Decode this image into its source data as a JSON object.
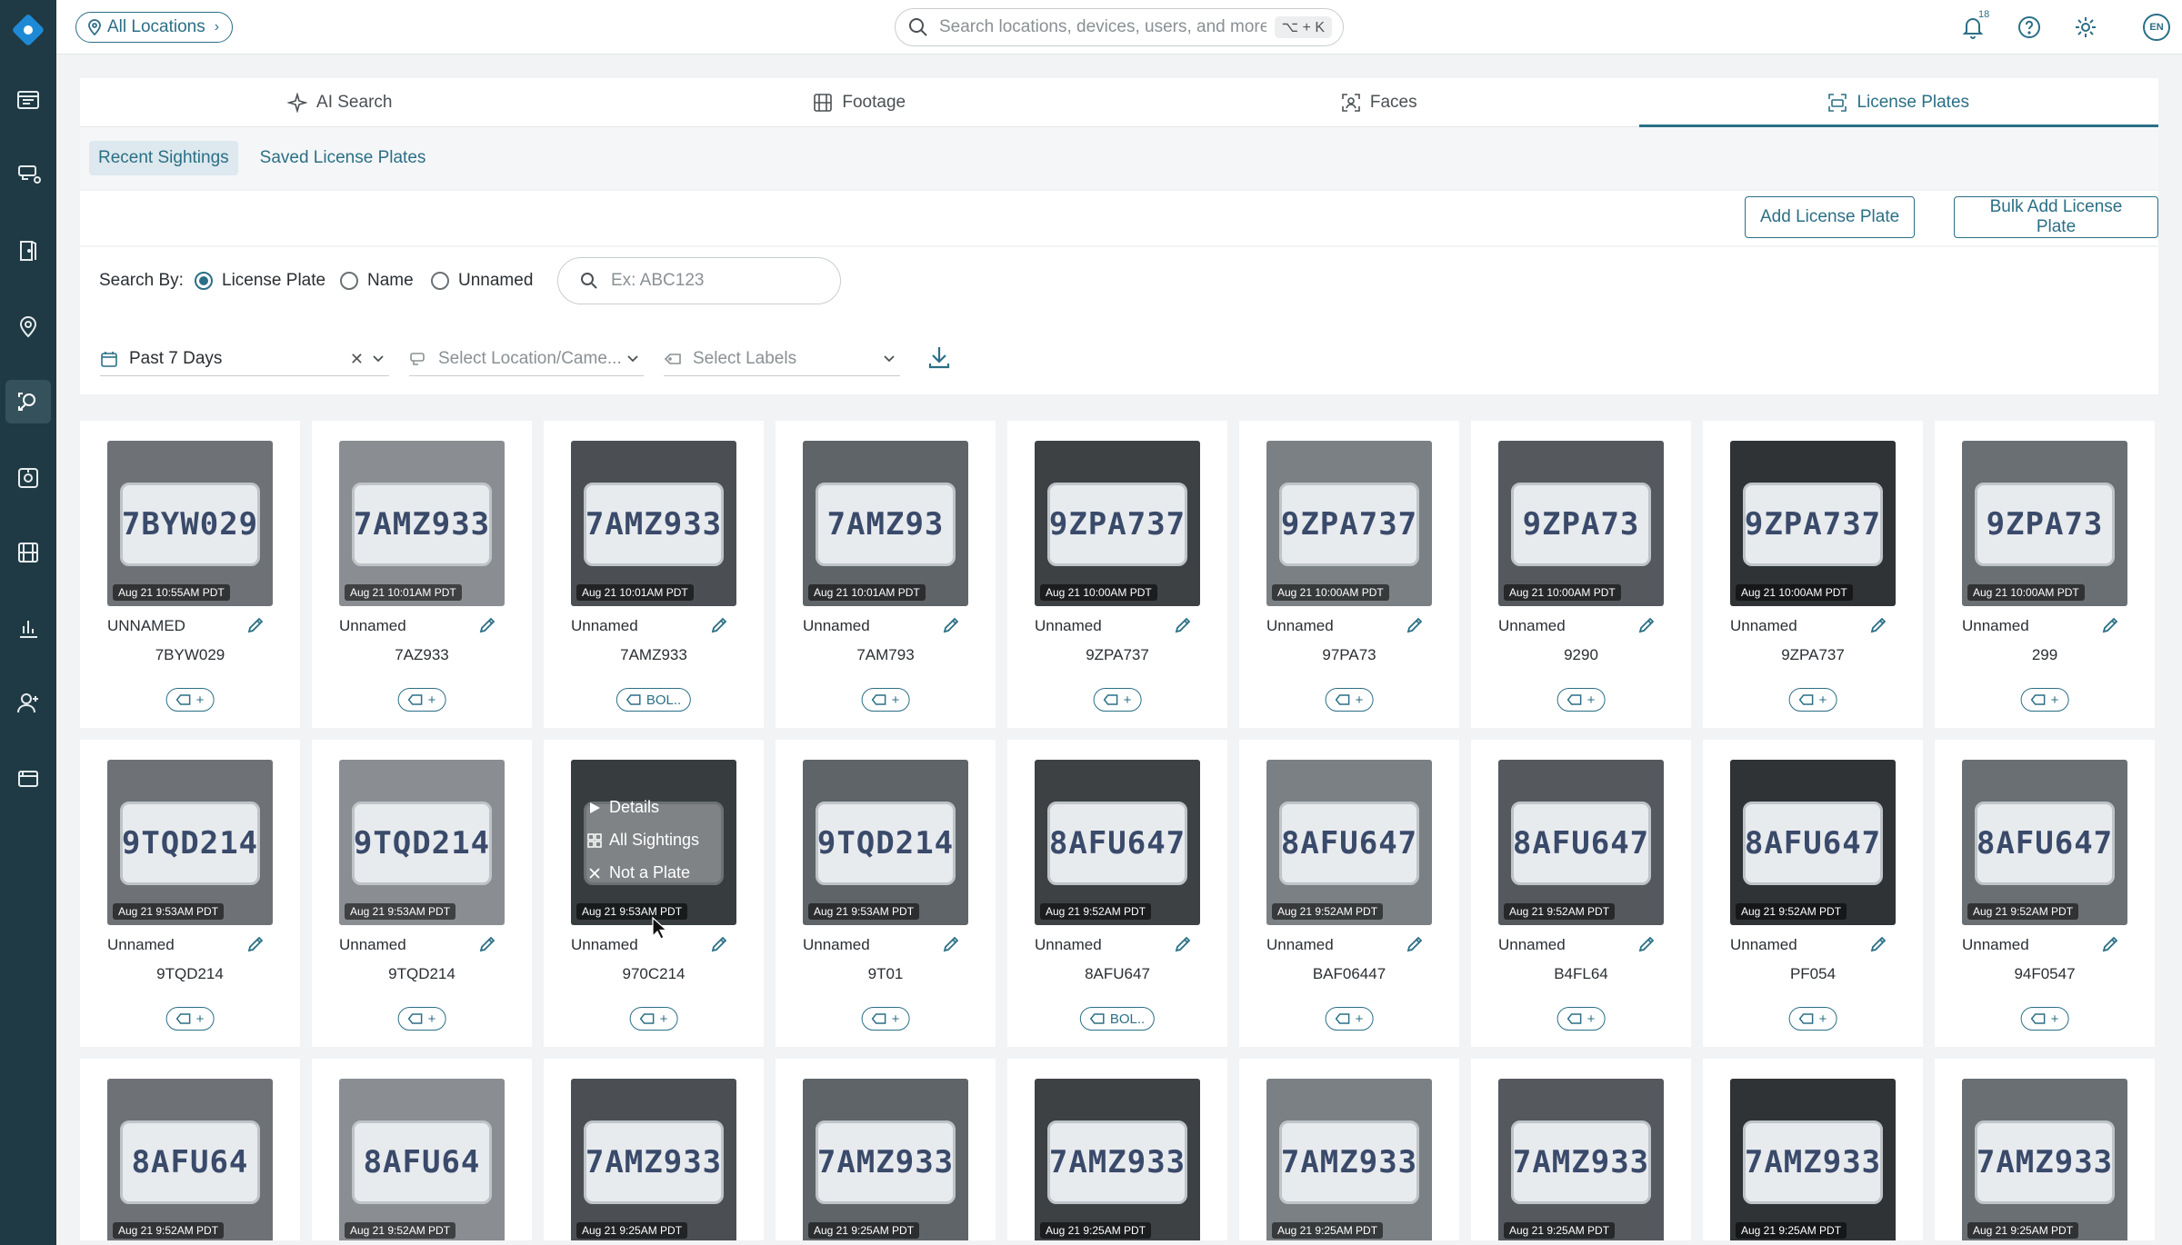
{
  "topbar": {
    "location_label": "All Locations",
    "search_placeholder": "Search locations, devices, users, and more",
    "search_shortcut": "⌥ + K",
    "notification_count": "18",
    "language": "EN"
  },
  "tabs": [
    {
      "label": "AI Search",
      "icon": "sparkle-icon",
      "active": false
    },
    {
      "label": "Footage",
      "icon": "film-icon",
      "active": false
    },
    {
      "label": "Faces",
      "icon": "face-scan-icon",
      "active": false
    },
    {
      "label": "License Plates",
      "icon": "plate-scan-icon",
      "active": true
    }
  ],
  "subtabs": [
    {
      "label": "Recent Sightings",
      "active": true
    },
    {
      "label": "Saved License Plates",
      "active": false
    }
  ],
  "actions": {
    "add_plate": "Add License Plate",
    "bulk_add": "Bulk Add License Plate"
  },
  "filters": {
    "search_by_label": "Search By:",
    "radios": [
      {
        "label": "License Plate",
        "checked": true
      },
      {
        "label": "Name",
        "checked": false
      },
      {
        "label": "Unnamed",
        "checked": false
      }
    ],
    "plate_placeholder": "Ex: ABC123",
    "date_range": "Past 7 Days",
    "location_placeholder": "Select Location/Came...",
    "labels_placeholder": "Select Labels"
  },
  "hover_menu": {
    "details": "Details",
    "all_sightings": "All Sightings",
    "not_a_plate": "Not a Plate"
  },
  "sightings": [
    {
      "time": "Aug 21 10:55AM PDT",
      "name": "UNNAMED",
      "plate": "7BYW029",
      "label": "",
      "image_text": "7BYW029"
    },
    {
      "time": "Aug 21 10:01AM PDT",
      "name": "Unnamed",
      "plate": "7AZ933",
      "label": "",
      "image_text": "7AMZ933"
    },
    {
      "time": "Aug 21 10:01AM PDT",
      "name": "Unnamed",
      "plate": "7AMZ933",
      "label": "BOL..",
      "image_text": "7AMZ933"
    },
    {
      "time": "Aug 21 10:01AM PDT",
      "name": "Unnamed",
      "plate": "7AM793",
      "label": "",
      "image_text": "7AMZ93"
    },
    {
      "time": "Aug 21 10:00AM PDT",
      "name": "Unnamed",
      "plate": "9ZPA737",
      "label": "",
      "image_text": "9ZPA737"
    },
    {
      "time": "Aug 21 10:00AM PDT",
      "name": "Unnamed",
      "plate": "97PA73",
      "label": "",
      "image_text": "9ZPA737"
    },
    {
      "time": "Aug 21 10:00AM PDT",
      "name": "Unnamed",
      "plate": "9290",
      "label": "",
      "image_text": "9ZPA73"
    },
    {
      "time": "Aug 21 10:00AM PDT",
      "name": "Unnamed",
      "plate": "9ZPA737",
      "label": "",
      "image_text": "9ZPA737"
    },
    {
      "time": "Aug 21 10:00AM PDT",
      "name": "Unnamed",
      "plate": "299",
      "label": "",
      "image_text": "9ZPA73"
    },
    {
      "time": "Aug 21 9:53AM PDT",
      "name": "Unnamed",
      "plate": "9TQD214",
      "label": "",
      "image_text": "9TQD214"
    },
    {
      "time": "Aug 21 9:53AM PDT",
      "name": "Unnamed",
      "plate": "9TQD214",
      "label": "",
      "image_text": "9TQD214"
    },
    {
      "time": "Aug 21 9:53AM PDT",
      "name": "Unnamed",
      "plate": "970C214",
      "label": "",
      "image_text": "",
      "hover": true
    },
    {
      "time": "Aug 21 9:53AM PDT",
      "name": "Unnamed",
      "plate": "9T01",
      "label": "",
      "image_text": "9TQD214"
    },
    {
      "time": "Aug 21 9:52AM PDT",
      "name": "Unnamed",
      "plate": "8AFU647",
      "label": "BOL..",
      "image_text": "8AFU647"
    },
    {
      "time": "Aug 21 9:52AM PDT",
      "name": "Unnamed",
      "plate": "BAF06447",
      "label": "",
      "image_text": "8AFU647"
    },
    {
      "time": "Aug 21 9:52AM PDT",
      "name": "Unnamed",
      "plate": "B4FL64",
      "label": "",
      "image_text": "8AFU647"
    },
    {
      "time": "Aug 21 9:52AM PDT",
      "name": "Unnamed",
      "plate": "PF054",
      "label": "",
      "image_text": "8AFU647"
    },
    {
      "time": "Aug 21 9:52AM PDT",
      "name": "Unnamed",
      "plate": "94F0547",
      "label": "",
      "image_text": "8AFU647"
    },
    {
      "time": "Aug 21 9:52AM PDT",
      "image_text": "8AFU64"
    },
    {
      "time": "Aug 21 9:52AM PDT",
      "image_text": "8AFU64"
    },
    {
      "time": "Aug 21 9:25AM PDT",
      "image_text": "7AMZ933"
    },
    {
      "time": "Aug 21 9:25AM PDT",
      "image_text": "7AMZ933"
    },
    {
      "time": "Aug 21 9:25AM PDT",
      "image_text": "7AMZ933"
    },
    {
      "time": "Aug 21 9:25AM PDT",
      "image_text": "7AMZ933"
    },
    {
      "time": "Aug 21 9:25AM PDT",
      "image_text": "7AMZ933"
    },
    {
      "time": "Aug 21 9:25AM PDT",
      "image_text": "7AMZ933"
    },
    {
      "time": "Aug 21 9:25AM PDT",
      "image_text": "7AMZ933"
    }
  ],
  "colors": {
    "sidebar": "#1f3a44",
    "accent": "#2b6f86",
    "logo": "#1e8ad6"
  }
}
